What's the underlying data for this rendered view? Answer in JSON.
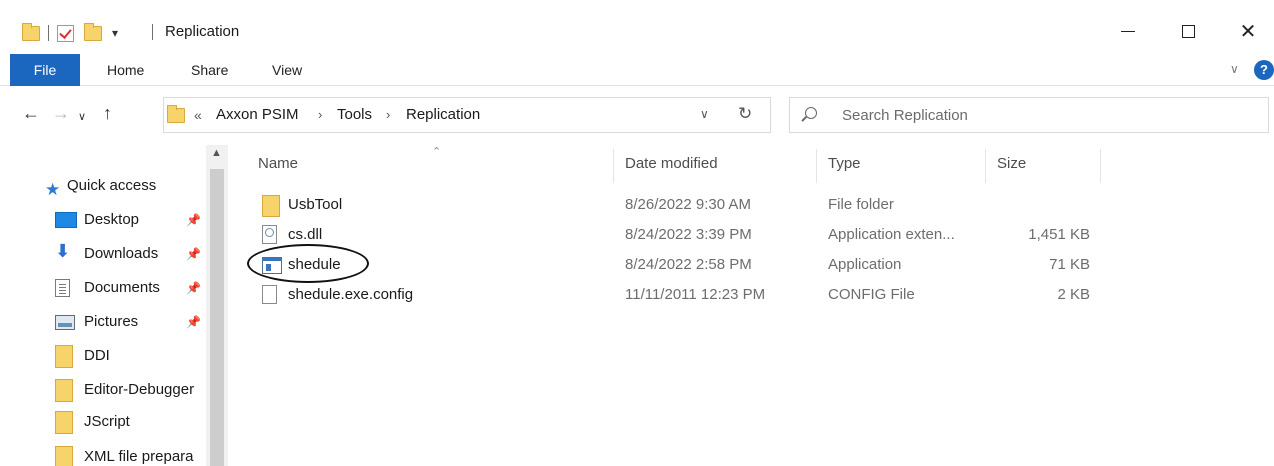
{
  "window": {
    "title": "Replication"
  },
  "ribbon": {
    "tabs": [
      {
        "label": "File"
      },
      {
        "label": "Home"
      },
      {
        "label": "Share"
      },
      {
        "label": "View"
      }
    ],
    "help_label": "?"
  },
  "navigation": {
    "breadcrumbs": [
      "Axxon PSIM",
      "Tools",
      "Replication"
    ],
    "overflow_marker": "«",
    "crumb_separator": "›",
    "search_placeholder": "Search Replication"
  },
  "nav_pane": {
    "quick_access_label": "Quick access",
    "items": [
      {
        "label": "Desktop",
        "icon": "desktop-icon",
        "pinned": true
      },
      {
        "label": "Downloads",
        "icon": "download-arrow-icon",
        "pinned": true
      },
      {
        "label": "Documents",
        "icon": "documents-icon",
        "pinned": true
      },
      {
        "label": "Pictures",
        "icon": "pictures-icon",
        "pinned": true
      },
      {
        "label": "DDI",
        "icon": "folder-icon",
        "pinned": false
      },
      {
        "label": "Editor-Debugger",
        "icon": "folder-icon",
        "pinned": false
      },
      {
        "label": "JScript",
        "icon": "folder-icon",
        "pinned": false
      },
      {
        "label": "XML file prepara",
        "icon": "folder-icon",
        "pinned": false
      }
    ]
  },
  "file_list": {
    "columns": {
      "name": "Name",
      "date": "Date modified",
      "type": "Type",
      "size": "Size"
    },
    "rows": [
      {
        "name": "UsbTool",
        "date": "8/26/2022 9:30 AM",
        "type": "File folder",
        "size": "",
        "icon": "folder-icon"
      },
      {
        "name": "cs.dll",
        "date": "8/24/2022 3:39 PM",
        "type": "Application exten...",
        "size": "1,451 KB",
        "icon": "dll-file-icon"
      },
      {
        "name": "shedule",
        "date": "8/24/2022 2:58 PM",
        "type": "Application",
        "size": "71 KB",
        "icon": "application-icon"
      },
      {
        "name": "shedule.exe.config",
        "date": "11/11/2011 12:23 PM",
        "type": "CONFIG File",
        "size": "2 KB",
        "icon": "config-file-icon"
      }
    ]
  },
  "colors": {
    "accent": "#1b67bf",
    "folder": "#f6d36b",
    "annotation": "#111111"
  }
}
